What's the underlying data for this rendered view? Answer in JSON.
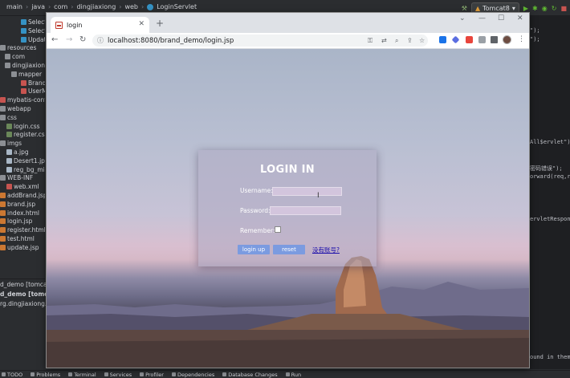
{
  "ide": {
    "breadcrumbs": [
      "main",
      "java",
      "com",
      "dingjiaxiong",
      "web",
      "LoginServlet"
    ],
    "run_config": "Tomcat8",
    "tree": [
      {
        "text": "Select",
        "color": "#3592c4",
        "indent": 26
      },
      {
        "text": "Select",
        "color": "#3592c4",
        "indent": 26
      },
      {
        "text": "Updat",
        "color": "#3592c4",
        "indent": 26
      },
      {
        "text": "resources",
        "color": "#8c8f94",
        "indent": 0
      },
      {
        "text": "com",
        "color": "#8c8f94",
        "indent": 6
      },
      {
        "text": "dingjiaxiong",
        "color": "#8c8f94",
        "indent": 6
      },
      {
        "text": "mapper",
        "color": "#8c8f94",
        "indent": 14
      },
      {
        "text": "BrandM",
        "color": "#c75450",
        "indent": 26
      },
      {
        "text": "UserM",
        "color": "#c75450",
        "indent": 26
      },
      {
        "text": "mybatis-config.x",
        "color": "#c75450",
        "indent": 0
      },
      {
        "text": "webapp",
        "color": "#8c8f94",
        "indent": 0
      },
      {
        "text": "css",
        "color": "#8c8f94",
        "indent": 0
      },
      {
        "text": "login.css",
        "color": "#6a8759",
        "indent": 8
      },
      {
        "text": "register.css",
        "color": "#6a8759",
        "indent": 8
      },
      {
        "text": "imgs",
        "color": "#8c8f94",
        "indent": 0
      },
      {
        "text": "a.jpg",
        "color": "#a9b7c6",
        "indent": 8
      },
      {
        "text": "Desert1.jpg",
        "color": "#a9b7c6",
        "indent": 8
      },
      {
        "text": "reg_bg_min.jp",
        "color": "#a9b7c6",
        "indent": 8
      },
      {
        "text": "WEB-INF",
        "color": "#8c8f94",
        "indent": 0
      },
      {
        "text": "web.xml",
        "color": "#c75450",
        "indent": 8
      },
      {
        "text": "addBrand.jsp",
        "color": "#cc7832",
        "indent": 0
      },
      {
        "text": "brand.jsp",
        "color": "#cc7832",
        "indent": 0
      },
      {
        "text": "index.html",
        "color": "#cc7832",
        "indent": 0
      },
      {
        "text": "login.jsp",
        "color": "#cc7832",
        "indent": 0
      },
      {
        "text": "register.html",
        "color": "#cc7832",
        "indent": 0
      },
      {
        "text": "test.html",
        "color": "#cc7832",
        "indent": 0
      },
      {
        "text": "update.jsp",
        "color": "#cc7832",
        "indent": 0
      }
    ],
    "run_panel": [
      "d_demo [tomcat7:",
      "d_demo [tomcat7:",
      "rg.dingjiaxiong.bran"
    ],
    "code_lines": [
      {
        "text": "\");",
        "row": 0
      },
      {
        "text": "\");",
        "row": 1
      },
      {
        "text": "All$ervlet\");",
        "row": 13
      },
      {
        "text": "密码错误\");",
        "row": 16
      },
      {
        "text": "orward(req,res",
        "row": 17
      },
      {
        "text": "ervletRespons",
        "row": 22
      },
      {
        "text": "ound in them. Sk",
        "row": 38
      }
    ],
    "status_items": [
      "TODO",
      "Problems",
      "Terminal",
      "Services",
      "Profiler",
      "Dependencies",
      "Database Changes",
      "Run"
    ]
  },
  "browser": {
    "tab_title": "login",
    "url": "localhost:8080/brand_demo/login.jsp"
  },
  "login_form": {
    "title": "LOGIN IN",
    "username_label": "Username:",
    "password_label": "Password:",
    "remember_label": "Remember:",
    "login_button": "login up",
    "reset_button": "reset",
    "register_link": "没有账号?"
  },
  "colors": {
    "button": "#7b9be0",
    "link": "#1a0dab",
    "ide_bg": "#2b2d30"
  }
}
